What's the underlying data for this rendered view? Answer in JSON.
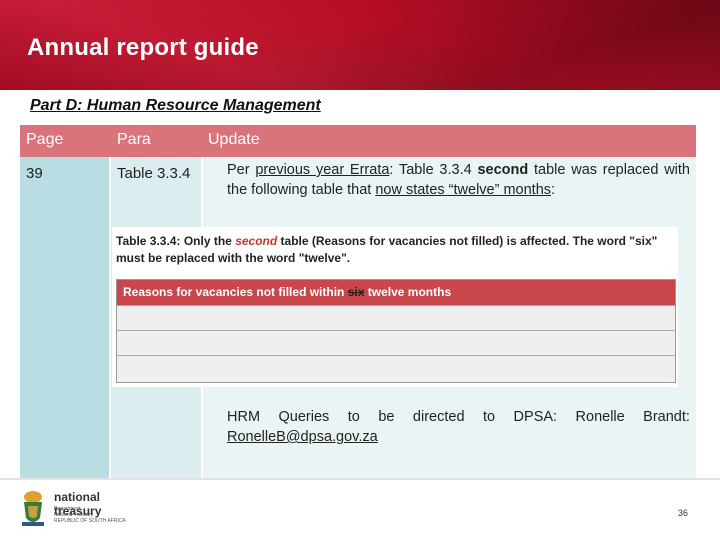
{
  "header": {
    "title": "Annual report guide",
    "subtitle": "Part D:  Human Resource Management"
  },
  "colors": {
    "banner": "#b50d25",
    "table_header": "#d9747a",
    "inner_table_header": "#c9474b"
  },
  "table": {
    "columns": [
      "Page",
      "Para",
      "Update"
    ],
    "row": {
      "page": "39",
      "para": "Table 3.3.4",
      "update": {
        "intro": "Per",
        "link": "previous year Errata",
        "mid1": ":  Table 3.3.4",
        "bold_word": "second",
        "mid2": "table was replaced with the following table that",
        "underlined": "now states “twelve” months",
        "end": ":"
      }
    }
  },
  "inner_figure": {
    "caption_label": "Table 3.3.4:",
    "caption_part1": "Only the",
    "caption_italic": "second",
    "caption_part2": "table (Reasons for vacancies not filled) is affected.  The word \"six\" must be replaced with the word \"twelve\".",
    "table_header_prefix": "Reasons for vacancies not filled within",
    "struck_word": "six",
    "table_header_suffix": "twelve months",
    "empty_rows": 3
  },
  "contact": {
    "prefix_words": [
      "HRM",
      "Queries",
      "to",
      "be",
      "directed",
      "to",
      "DPSA:",
      "Ronelle",
      "Brandt:"
    ],
    "email": "RonelleB@dpsa.gov.za"
  },
  "footer": {
    "logo_name": "national treasury",
    "logo_lines": [
      "Department:",
      "National Treasury",
      "REPUBLIC OF SOUTH AFRICA"
    ],
    "page_number": "36"
  }
}
